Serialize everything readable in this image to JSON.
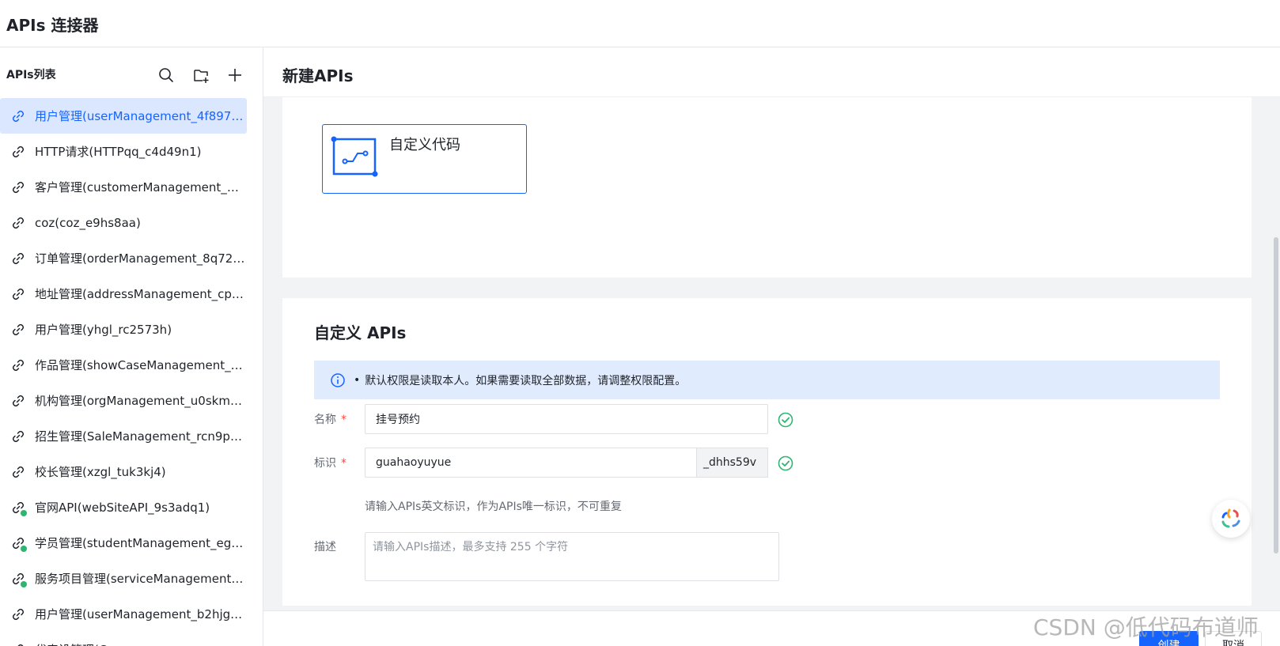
{
  "app": {
    "title": "APIs 连接器"
  },
  "sidebar": {
    "title": "APIs列表",
    "items": [
      {
        "label": "用户管理(userManagement_4f8978b)",
        "active": true,
        "published": false
      },
      {
        "label": "HTTP请求(HTTPqq_c4d49n1)",
        "active": false,
        "published": false
      },
      {
        "label": "客户管理(customerManagement_2fy3...",
        "active": false,
        "published": false
      },
      {
        "label": "coz(coz_e9hs8aa)",
        "active": false,
        "published": false
      },
      {
        "label": "订单管理(orderManagement_8q72kth)",
        "active": false,
        "published": false
      },
      {
        "label": "地址管理(addressManagement_cpyzq...",
        "active": false,
        "published": false
      },
      {
        "label": "用户管理(yhgl_rc2573h)",
        "active": false,
        "published": false
      },
      {
        "label": "作品管理(showCaseManagement_yjjm...",
        "active": false,
        "published": false
      },
      {
        "label": "机构管理(orgManagement_u0skmr2)",
        "active": false,
        "published": false
      },
      {
        "label": "招生管理(SaleManagement_rcn9py4)",
        "active": false,
        "published": false
      },
      {
        "label": "校长管理(xzgl_tuk3kj4)",
        "active": false,
        "published": false
      },
      {
        "label": "官网API(webSiteAPI_9s3adq1)",
        "active": false,
        "published": true
      },
      {
        "label": "学员管理(studentManagement_eg7jud...",
        "active": false,
        "published": true
      },
      {
        "label": "服务项目管理(serviceManagement_wf...",
        "active": false,
        "published": true
      },
      {
        "label": "用户管理(userManagement_b2hjgd4)",
        "active": false,
        "published": false
      },
      {
        "label": "代表设管理(Company...",
        "active": false,
        "published": false
      }
    ]
  },
  "main": {
    "title": "新建APIs",
    "template_label": "自定义代码",
    "section_title": "自定义 APIs",
    "notice": "默认权限是读取本人。如果需要读取全部数据，请调整权限配置。",
    "form": {
      "name_label": "名称",
      "name_value": "挂号预约",
      "id_label": "标识",
      "id_value": "guahaoyuyue",
      "id_suffix": "_dhhs59v",
      "id_hint": "请输入APIs英文标识，作为APIs唯一标识，不可重复",
      "desc_label": "描述",
      "desc_placeholder": "请输入APIs描述，最多支持 255 个字符",
      "required_mark": "*"
    },
    "footer": {
      "create_label": "创建",
      "cancel_label": "取消"
    }
  },
  "watermark": "CSDN @低代码布道师",
  "colors": {
    "accent": "#1664ff",
    "active_bg": "#dbe7fe",
    "success": "#2fb56f",
    "required": "#f54a45"
  }
}
